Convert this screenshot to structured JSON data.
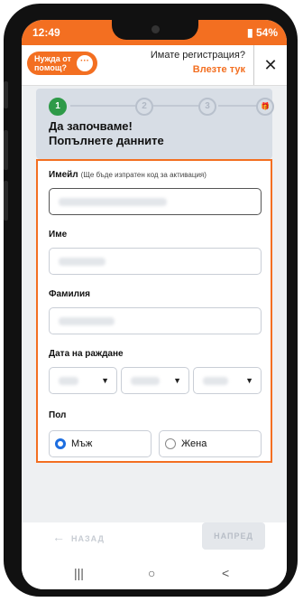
{
  "status": {
    "time": "12:49",
    "battery": "54%"
  },
  "topbar": {
    "help_label": "Нужда от помощ?",
    "help_icon": "chat-bubble-icon",
    "registration_question": "Имате регистрация?",
    "login_link": "Влезте тук",
    "close_label": "✕"
  },
  "stepper": {
    "steps": [
      "1",
      "2",
      "3",
      "🎁"
    ],
    "active_step": 1,
    "title_line1": "Да започваме!",
    "title_line2": "Попълнете данните"
  },
  "form": {
    "email_label": "Имейл",
    "email_hint": "(Ще бъде изпратен код за активация)",
    "first_name_label": "Име",
    "last_name_label": "Фамилия",
    "birthdate_label": "Дата на раждане",
    "gender_label": "Пол",
    "gender_options": [
      "Мъж",
      "Жена"
    ],
    "gender_selected": "Мъж"
  },
  "footer": {
    "back_label": "НАЗАД",
    "next_label": "НАПРЕД"
  },
  "navbar": {
    "recents": "|||",
    "home": "○",
    "back": "<"
  },
  "colors": {
    "accent": "#f36f21",
    "step_active": "#2e9a48",
    "radio": "#1d6ee0"
  }
}
